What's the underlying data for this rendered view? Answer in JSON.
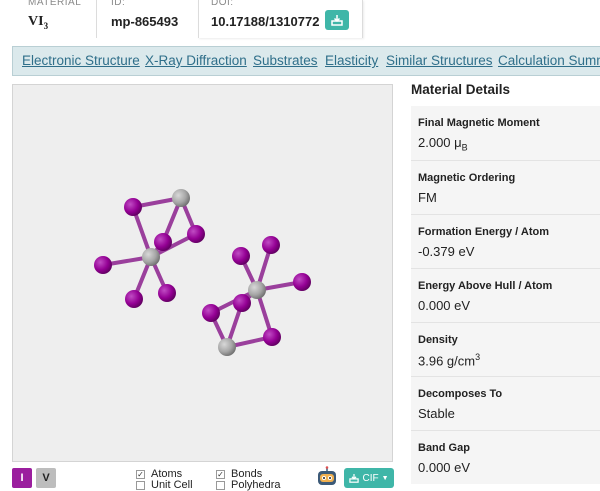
{
  "header": {
    "material_label": "MATERIAL",
    "material_base": "VI",
    "material_sub": "3",
    "id_label": "ID:",
    "id_value": "mp-865493",
    "doi_label": "DOI:",
    "doi_value": "10.17188/1310772",
    "doi_button_icon": "download-icon"
  },
  "tabs": [
    "Electronic Structure",
    "X-Ray Diffraction",
    "Substrates",
    "Elasticity",
    "Similar Structures",
    "Calculation Summary"
  ],
  "viewer": {
    "atom_colors": {
      "I": "#940094",
      "V": "#a6a6a6"
    },
    "element_buttons": [
      "I",
      "V"
    ],
    "checkboxes": [
      {
        "label": "Atoms",
        "checked": true
      },
      {
        "label": "Unit Cell",
        "checked": false
      },
      {
        "label": "Bonds",
        "checked": true
      },
      {
        "label": "Polyhedra",
        "checked": false
      }
    ],
    "cif_button": "CIF",
    "robot_icon": "robot-icon"
  },
  "details": {
    "title": "Material Details",
    "properties": [
      {
        "label": "Final Magnetic Moment",
        "value": "2.000 μ",
        "sub": "B"
      },
      {
        "label": "Magnetic Ordering",
        "value": "FM"
      },
      {
        "label": "Formation Energy / Atom",
        "value": "-0.379 eV"
      },
      {
        "label": "Energy Above Hull / Atom",
        "value": "0.000 eV"
      },
      {
        "label": "Density",
        "value": "3.96 g/cm",
        "sup": "3"
      },
      {
        "label": "Decomposes To",
        "value": "Stable"
      },
      {
        "label": "Band Gap",
        "value": "0.000 eV"
      }
    ]
  }
}
